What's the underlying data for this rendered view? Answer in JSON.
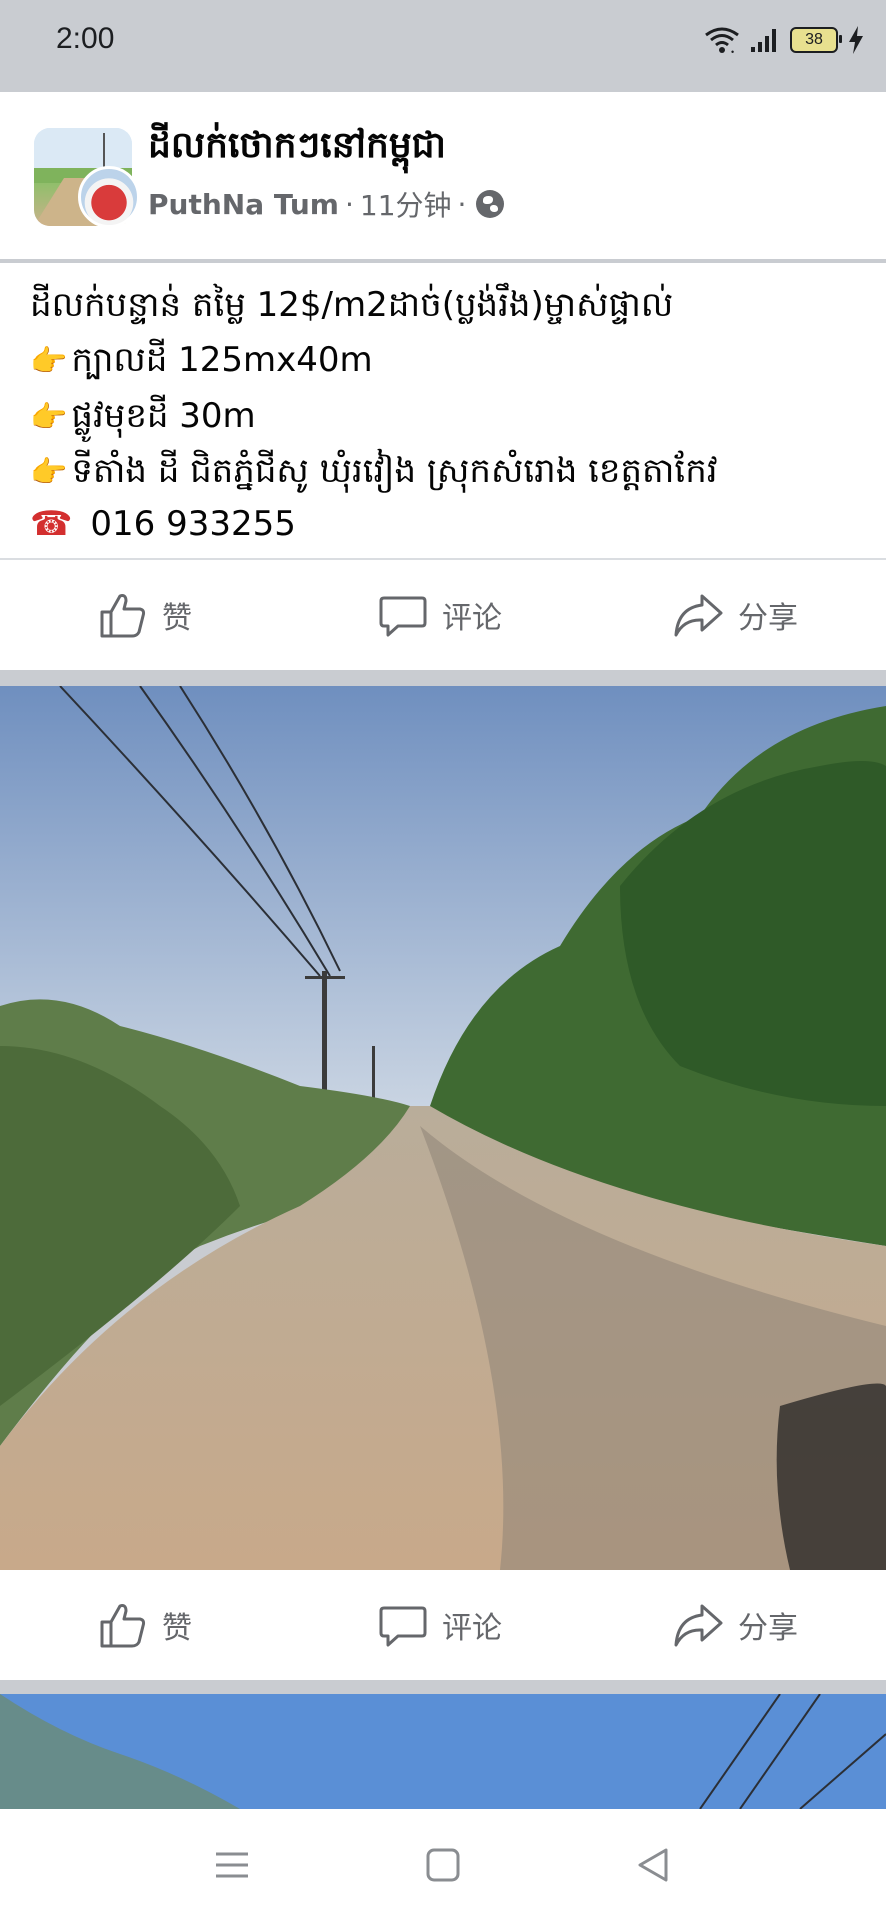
{
  "status": {
    "time": "2:00",
    "battery": "38"
  },
  "post": {
    "group_name": "ដីលក់ថោកៗនៅកម្ពុជា",
    "author": "PuthNa Tum",
    "time_ago": "11分钟",
    "separator": "·",
    "lines": [
      "ដីលក់បន្ទាន់ តម្លៃ 12$/m2ដាច់(ប្លង់រឹង)ម្ចាស់ផ្ទាល់",
      "ក្បាលដី 125mx40m",
      "ផ្លូវមុខដី 30m",
      "ទីតាំង ដី ជិតភ្នំជីសូ  ឃុំរវៀង ស្រុកសំរោង ខេត្តតាកែវ",
      "016 933255"
    ],
    "hand_emoji": "👉",
    "phone_emoji": "☎"
  },
  "actions": {
    "like": "赞",
    "comment": "评论",
    "share": "分享"
  },
  "icons": {
    "like": "thumbs-up-icon",
    "comment": "comment-icon",
    "share": "share-icon",
    "globe": "globe-icon"
  }
}
